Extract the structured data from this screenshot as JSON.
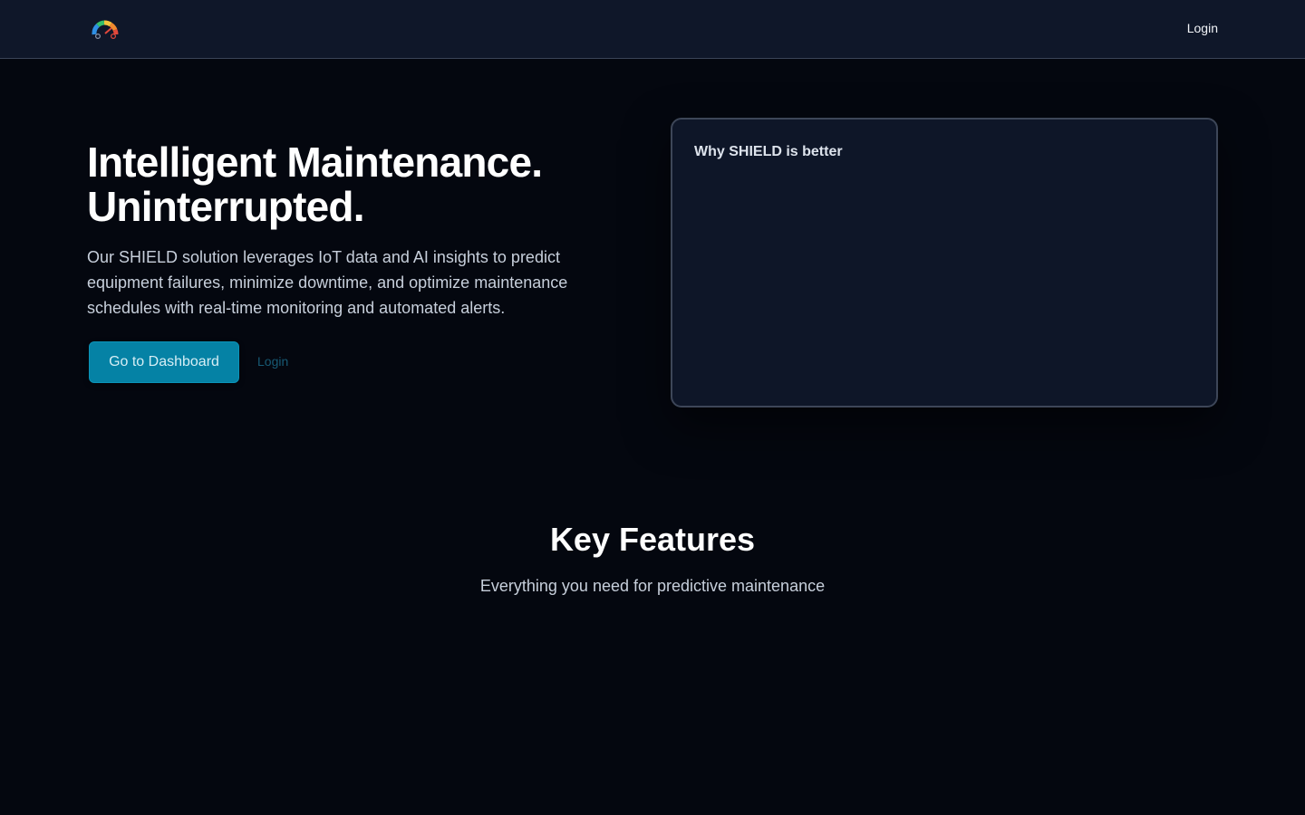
{
  "header": {
    "logo_icon": "gauge-logo-icon",
    "login_label": "Login"
  },
  "hero": {
    "title_line1": "Intelligent Maintenance.",
    "title_line2": "Uninterrupted.",
    "description": "Our SHIELD solution leverages IoT data and AI insights to predict equipment failures, minimize downtime, and optimize maintenance schedules with real-time monitoring and automated alerts.",
    "dashboard_button": "Go to Dashboard",
    "login_link": "Login"
  },
  "why_card": {
    "title": "Why SHIELD is better"
  },
  "features": {
    "title": "Key Features",
    "subtitle": "Everything you need for predictive maintenance"
  },
  "colors": {
    "page_background": "#04070f",
    "header_background": "#0f1729",
    "accent": "#0582a5",
    "card_background": "#0e1628",
    "card_border": "#3d4658"
  }
}
